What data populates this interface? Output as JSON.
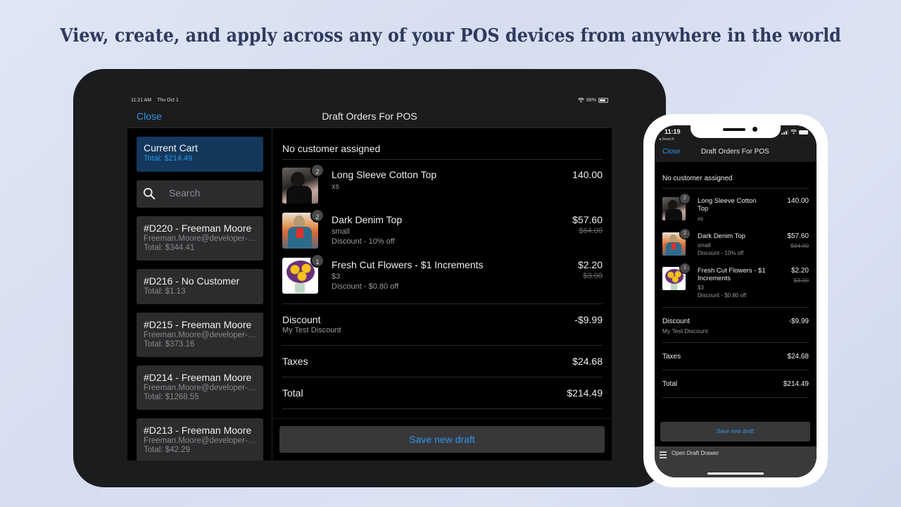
{
  "headline": "View, create, and apply across any of your POS devices from anywhere in the world",
  "tablet": {
    "status": {
      "time": "11:21 AM",
      "date": "Thu Oct 1",
      "battery": "68%"
    },
    "nav": {
      "close": "Close",
      "title": "Draft Orders For POS"
    },
    "sidebar": {
      "current_cart": {
        "title": "Current Cart",
        "total": "Total: $214.49"
      },
      "search_placeholder": "Search",
      "drafts": [
        {
          "title": "#D220 - Freeman Moore",
          "email": "Freeman.Moore@developer-t...",
          "total": "Total: $344.41"
        },
        {
          "title": "#D216 - No Customer",
          "email": "",
          "total": "Total: $1.13"
        },
        {
          "title": "#D215 - Freeman Moore",
          "email": "Freeman.Moore@developer-t...",
          "total": "Total: $373.16"
        },
        {
          "title": "#D214 - Freeman Moore",
          "email": "Freeman.Moore@developer-t...",
          "total": "Total: $1268.55"
        },
        {
          "title": "#D213 - Freeman Moore",
          "email": "Freeman.Moore@developer-t...",
          "total": "Total: $42.29"
        }
      ]
    },
    "main": {
      "customer": "No customer assigned",
      "items": [
        {
          "qty": "2",
          "name": "Long Sleeve Cotton Top",
          "variant": "xs",
          "discount": "",
          "price": "140.00",
          "original": ""
        },
        {
          "qty": "2",
          "name": "Dark Denim Top",
          "variant": "small",
          "discount": "Discount - 10% off",
          "price": "$57.60",
          "original": "$64.00"
        },
        {
          "qty": "1",
          "name": "Fresh Cut Flowers - $1 Increments",
          "variant": "$3",
          "discount": "Discount - $0.80 off",
          "price": "$2.20",
          "original": "$3.00"
        }
      ],
      "discount": {
        "label": "Discount",
        "name": "My Test Discount",
        "value": "-$9.99"
      },
      "taxes": {
        "label": "Taxes",
        "value": "$24.68"
      },
      "total": {
        "label": "Total",
        "value": "$214.49"
      },
      "save_button": "Save new draft"
    }
  },
  "phone": {
    "status": {
      "time": "11:19",
      "back": "◂ Search"
    },
    "nav": {
      "close": "Close",
      "title": "Draft Orders For POS"
    },
    "main": {
      "customer": "No customer assigned",
      "items": [
        {
          "qty": "2",
          "name": "Long Sleeve Cotton Top",
          "variant": "xs",
          "discount": "",
          "price": "140.00",
          "original": ""
        },
        {
          "qty": "2",
          "name": "Dark Denim Top",
          "variant": "small",
          "discount": "Discount - 10% off",
          "price": "$57.60",
          "original": "$64.00"
        },
        {
          "qty": "1",
          "name": "Fresh Cut Flowers - $1 Increments",
          "variant": "$3",
          "discount": "Discount - $0.80 off",
          "price": "$2.20",
          "original": "$3.00"
        }
      ],
      "discount": {
        "label": "Discount",
        "name": "My Test Discount",
        "value": "-$9.99"
      },
      "taxes": {
        "label": "Taxes",
        "value": "$24.68"
      },
      "total": {
        "label": "Total",
        "value": "$214.49"
      },
      "save_button": "Save new draft",
      "drawer": "Open Draft Drawer"
    }
  },
  "colors": {
    "accent": "#2f95e8",
    "cart_card": "#13385c",
    "headline": "#2e3a5e"
  }
}
